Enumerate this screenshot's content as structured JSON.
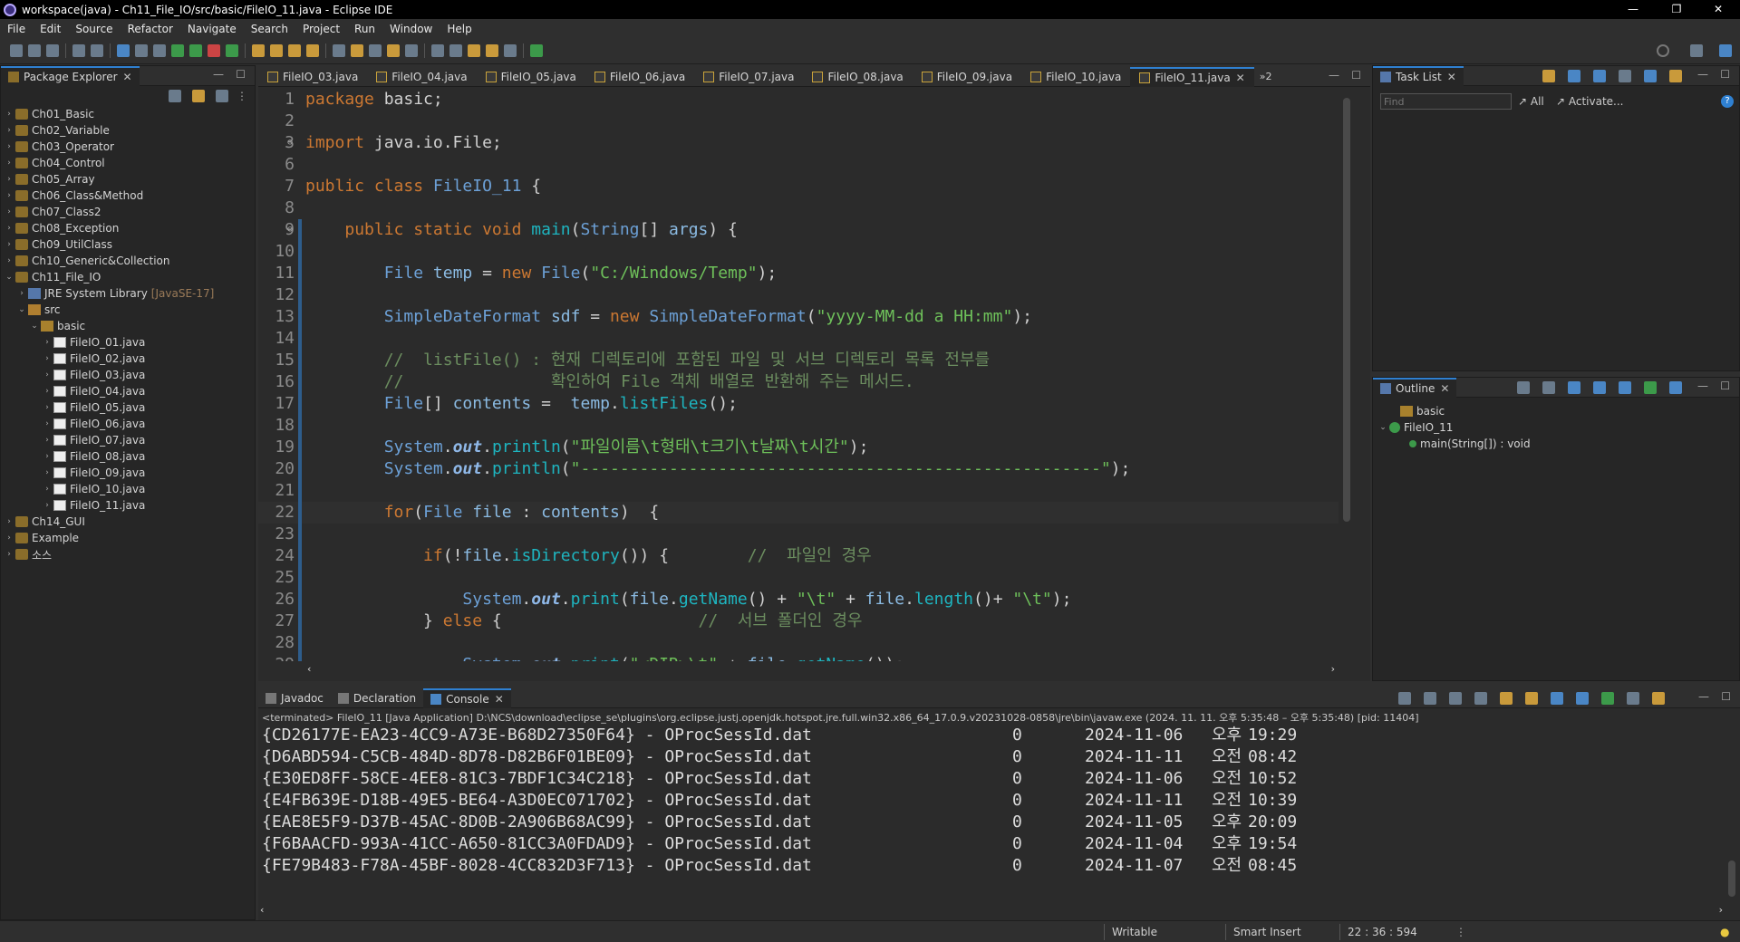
{
  "window": {
    "title": "workspace(java) - Ch11_File_IO/src/basic/FileIO_11.java - Eclipse IDE",
    "minimize": "—",
    "restore": "❐",
    "close": "✕"
  },
  "menu": [
    "File",
    "Edit",
    "Source",
    "Refactor",
    "Navigate",
    "Search",
    "Project",
    "Run",
    "Window",
    "Help"
  ],
  "package_explorer": {
    "tab": "Package Explorer",
    "items": [
      {
        "label": "Ch01_Basic",
        "type": "project",
        "indent": 0
      },
      {
        "label": "Ch02_Variable",
        "type": "project",
        "indent": 0
      },
      {
        "label": "Ch03_Operator",
        "type": "project",
        "indent": 0
      },
      {
        "label": "Ch04_Control",
        "type": "project",
        "indent": 0
      },
      {
        "label": "Ch05_Array",
        "type": "project",
        "indent": 0
      },
      {
        "label": "Ch06_Class&Method",
        "type": "project",
        "indent": 0
      },
      {
        "label": "Ch07_Class2",
        "type": "project",
        "indent": 0
      },
      {
        "label": "Ch08_Exception",
        "type": "project",
        "indent": 0
      },
      {
        "label": "Ch09_UtilClass",
        "type": "project",
        "indent": 0
      },
      {
        "label": "Ch10_Generic&Collection",
        "type": "project",
        "indent": 0
      },
      {
        "label": "Ch11_File_IO",
        "type": "project",
        "indent": 0,
        "open": true
      },
      {
        "label": "JRE System Library",
        "suffix": "[JavaSE-17]",
        "type": "jre",
        "indent": 1
      },
      {
        "label": "src",
        "type": "src",
        "indent": 1,
        "open": true
      },
      {
        "label": "basic",
        "type": "pkg",
        "indent": 2,
        "open": true
      },
      {
        "label": "FileIO_01.java",
        "type": "file",
        "indent": 3
      },
      {
        "label": "FileIO_02.java",
        "type": "file",
        "indent": 3
      },
      {
        "label": "FileIO_03.java",
        "type": "file",
        "indent": 3
      },
      {
        "label": "FileIO_04.java",
        "type": "file",
        "indent": 3
      },
      {
        "label": "FileIO_05.java",
        "type": "file",
        "indent": 3
      },
      {
        "label": "FileIO_06.java",
        "type": "file",
        "indent": 3
      },
      {
        "label": "FileIO_07.java",
        "type": "file",
        "indent": 3
      },
      {
        "label": "FileIO_08.java",
        "type": "file",
        "indent": 3
      },
      {
        "label": "FileIO_09.java",
        "type": "file",
        "indent": 3
      },
      {
        "label": "FileIO_10.java",
        "type": "file",
        "indent": 3
      },
      {
        "label": "FileIO_11.java",
        "type": "file",
        "indent": 3
      },
      {
        "label": "Ch14_GUI",
        "type": "project",
        "indent": 0
      },
      {
        "label": "Example",
        "type": "project",
        "indent": 0
      },
      {
        "label": "소스",
        "type": "project",
        "indent": 0
      }
    ]
  },
  "editor_tabs": [
    "FileIO_03.java",
    "FileIO_04.java",
    "FileIO_05.java",
    "FileIO_06.java",
    "FileIO_07.java",
    "FileIO_08.java",
    "FileIO_09.java",
    "FileIO_10.java",
    "FileIO_11.java"
  ],
  "editor_overflow": "»2",
  "code_lines": [
    {
      "n": "1",
      "segs": [
        [
          "kw",
          "package "
        ],
        [
          "st",
          "basic;"
        ]
      ]
    },
    {
      "n": "2",
      "segs": []
    },
    {
      "n": "3",
      "fold": true,
      "segs": [
        [
          "kw",
          "import "
        ],
        [
          "st",
          "java.io.File;"
        ]
      ]
    },
    {
      "n": "6",
      "segs": []
    },
    {
      "n": "7",
      "segs": [
        [
          "kw",
          "public class "
        ],
        [
          "ty",
          "FileIO_11"
        ],
        [
          "st",
          " {"
        ]
      ]
    },
    {
      "n": "8",
      "segs": []
    },
    {
      "n": "9",
      "fold": true,
      "segs": [
        [
          "st",
          "    "
        ],
        [
          "kw",
          "public static void "
        ],
        [
          "mth",
          "main"
        ],
        [
          "st",
          "("
        ],
        [
          "ty",
          "String"
        ],
        [
          "st",
          "[] "
        ],
        [
          "fld",
          "args"
        ],
        [
          "st",
          ") {"
        ]
      ]
    },
    {
      "n": "10",
      "segs": []
    },
    {
      "n": "11",
      "segs": [
        [
          "st",
          "        "
        ],
        [
          "ty",
          "File "
        ],
        [
          "fld",
          "temp"
        ],
        [
          "st",
          " = "
        ],
        [
          "kw",
          "new "
        ],
        [
          "ty",
          "File"
        ],
        [
          "st",
          "("
        ],
        [
          "str",
          "\"C:/Windows/Temp\""
        ],
        [
          "st",
          ");"
        ]
      ]
    },
    {
      "n": "12",
      "segs": []
    },
    {
      "n": "13",
      "segs": [
        [
          "st",
          "        "
        ],
        [
          "ty",
          "SimpleDateFormat "
        ],
        [
          "fld",
          "sdf"
        ],
        [
          "st",
          " = "
        ],
        [
          "kw",
          "new "
        ],
        [
          "ty",
          "SimpleDateFormat"
        ],
        [
          "st",
          "("
        ],
        [
          "str",
          "\"yyyy-MM-dd a HH:mm\""
        ],
        [
          "st",
          ");"
        ]
      ]
    },
    {
      "n": "14",
      "segs": []
    },
    {
      "n": "15",
      "segs": [
        [
          "st",
          "        "
        ],
        [
          "cm",
          "//  listFile() : 현재 디렉토리에 포함된 파일 및 서브 디렉토리 목록 전부를"
        ]
      ]
    },
    {
      "n": "16",
      "segs": [
        [
          "st",
          "        "
        ],
        [
          "cm",
          "//               확인하여 File 객체 배열로 반환해 주는 메서드."
        ]
      ]
    },
    {
      "n": "17",
      "segs": [
        [
          "st",
          "        "
        ],
        [
          "ty",
          "File"
        ],
        [
          "st",
          "[] "
        ],
        [
          "fld",
          "contents"
        ],
        [
          "st",
          " =  "
        ],
        [
          "fld",
          "temp"
        ],
        [
          "st",
          "."
        ],
        [
          "mth",
          "listFiles"
        ],
        [
          "st",
          "();"
        ]
      ]
    },
    {
      "n": "18",
      "segs": []
    },
    {
      "n": "19",
      "segs": [
        [
          "st",
          "        "
        ],
        [
          "ty",
          "System"
        ],
        [
          "st",
          "."
        ],
        [
          "it",
          "out"
        ],
        [
          "st",
          "."
        ],
        [
          "mth",
          "println"
        ],
        [
          "st",
          "("
        ],
        [
          "str",
          "\"파일이름\\t형태\\t크기\\t날짜\\t시간\""
        ],
        [
          "st",
          ");"
        ]
      ]
    },
    {
      "n": "20",
      "segs": [
        [
          "st",
          "        "
        ],
        [
          "ty",
          "System"
        ],
        [
          "st",
          "."
        ],
        [
          "it",
          "out"
        ],
        [
          "st",
          "."
        ],
        [
          "mth",
          "println"
        ],
        [
          "st",
          "("
        ],
        [
          "str",
          "\"-----------------------------------------------------\""
        ],
        [
          "st",
          ");"
        ]
      ]
    },
    {
      "n": "21",
      "segs": []
    },
    {
      "n": "22",
      "cur": true,
      "segs": [
        [
          "st",
          "        "
        ],
        [
          "kw",
          "for"
        ],
        [
          "st",
          "("
        ],
        [
          "ty",
          "File "
        ],
        [
          "fld",
          "file"
        ],
        [
          "st",
          " : "
        ],
        [
          "fld",
          "contents"
        ],
        [
          "st",
          ")  {"
        ]
      ]
    },
    {
      "n": "23",
      "segs": []
    },
    {
      "n": "24",
      "segs": [
        [
          "st",
          "            "
        ],
        [
          "kw",
          "if"
        ],
        [
          "st",
          "(!"
        ],
        [
          "fld",
          "file"
        ],
        [
          "st",
          "."
        ],
        [
          "mth",
          "isDirectory"
        ],
        [
          "st",
          "()) {        "
        ],
        [
          "cm",
          "//  파일인 경우"
        ]
      ]
    },
    {
      "n": "25",
      "segs": []
    },
    {
      "n": "26",
      "segs": [
        [
          "st",
          "                "
        ],
        [
          "ty",
          "System"
        ],
        [
          "st",
          "."
        ],
        [
          "it",
          "out"
        ],
        [
          "st",
          "."
        ],
        [
          "mth",
          "print"
        ],
        [
          "st",
          "("
        ],
        [
          "fld",
          "file"
        ],
        [
          "st",
          "."
        ],
        [
          "mth",
          "getName"
        ],
        [
          "st",
          "() + "
        ],
        [
          "str",
          "\"\\t\""
        ],
        [
          "st",
          " + "
        ],
        [
          "fld",
          "file"
        ],
        [
          "st",
          "."
        ],
        [
          "mth",
          "length"
        ],
        [
          "st",
          "()+ "
        ],
        [
          "str",
          "\"\\t\""
        ],
        [
          "st",
          ");"
        ]
      ]
    },
    {
      "n": "27",
      "segs": [
        [
          "st",
          "            } "
        ],
        [
          "kw",
          "else"
        ],
        [
          "st",
          " {                    "
        ],
        [
          "cm",
          "//  서브 폴더인 경우"
        ]
      ]
    },
    {
      "n": "28",
      "segs": []
    },
    {
      "n": "29",
      "segs": [
        [
          "st",
          "                "
        ],
        [
          "ty",
          "System"
        ],
        [
          "st",
          "."
        ],
        [
          "it",
          "out"
        ],
        [
          "st",
          "."
        ],
        [
          "mth",
          "print"
        ],
        [
          "st",
          "("
        ],
        [
          "str",
          "\"<DIR>\\t\""
        ],
        [
          "st",
          " + "
        ],
        [
          "fld",
          "file"
        ],
        [
          "st",
          "."
        ],
        [
          "mth",
          "getName"
        ],
        [
          "st",
          "());"
        ]
      ]
    }
  ],
  "task_list": {
    "tab": "Task List",
    "find_placeholder": "Find",
    "all": "All",
    "activate": "Activate..."
  },
  "outline": {
    "tab": "Outline",
    "items": [
      {
        "label": "basic"
      },
      {
        "label": "FileIO_11"
      },
      {
        "label": "main(String[]) : void"
      }
    ]
  },
  "bottom_tabs": [
    "Javadoc",
    "Declaration",
    "Console"
  ],
  "console_header": "<terminated> FileIO_11 [Java Application] D:\\NCS\\download\\eclipse_se\\plugins\\org.eclipse.justj.openjdk.hotspot.jre.full.win32.x86_64_17.0.9.v20231028-0858\\jre\\bin\\javaw.exe  (2024. 11. 11. 오후 5:35:48 – 오후 5:35:48) [pid: 11404]",
  "console_rows": [
    {
      "name": "{CD26177E-EA23-4CC9-A73E-B68D27350F64} - OProcSessId.dat",
      "size": "0",
      "date": "2024-11-06",
      "ampm": "오후",
      "time": "19:29"
    },
    {
      "name": "{D6ABD594-C5CB-484D-8D78-D82B6F01BE09} - OProcSessId.dat",
      "size": "0",
      "date": "2024-11-11",
      "ampm": "오전",
      "time": "08:42"
    },
    {
      "name": "{E30ED8FF-58CE-4EE8-81C3-7BDF1C34C218} - OProcSessId.dat",
      "size": "0",
      "date": "2024-11-06",
      "ampm": "오전",
      "time": "10:52"
    },
    {
      "name": "{E4FB639E-D18B-49E5-BE64-A3D0EC071702} - OProcSessId.dat",
      "size": "0",
      "date": "2024-11-11",
      "ampm": "오전",
      "time": "10:39"
    },
    {
      "name": "{EAE8E5F9-D37B-45AC-8D0B-2A906B68AC99} - OProcSessId.dat",
      "size": "0",
      "date": "2024-11-05",
      "ampm": "오후",
      "time": "20:09"
    },
    {
      "name": "{F6BAACFD-993A-41CC-A650-81CC3A0FDAD9} - OProcSessId.dat",
      "size": "0",
      "date": "2024-11-04",
      "ampm": "오후",
      "time": "19:54"
    },
    {
      "name": "{FE79B483-F78A-45BF-8028-4CC832D3F713} - OProcSessId.dat",
      "size": "0",
      "date": "2024-11-07",
      "ampm": "오전",
      "time": "08:45"
    }
  ],
  "status": {
    "writable": "Writable",
    "insert": "Smart Insert",
    "position": "22 : 36 : 594"
  }
}
